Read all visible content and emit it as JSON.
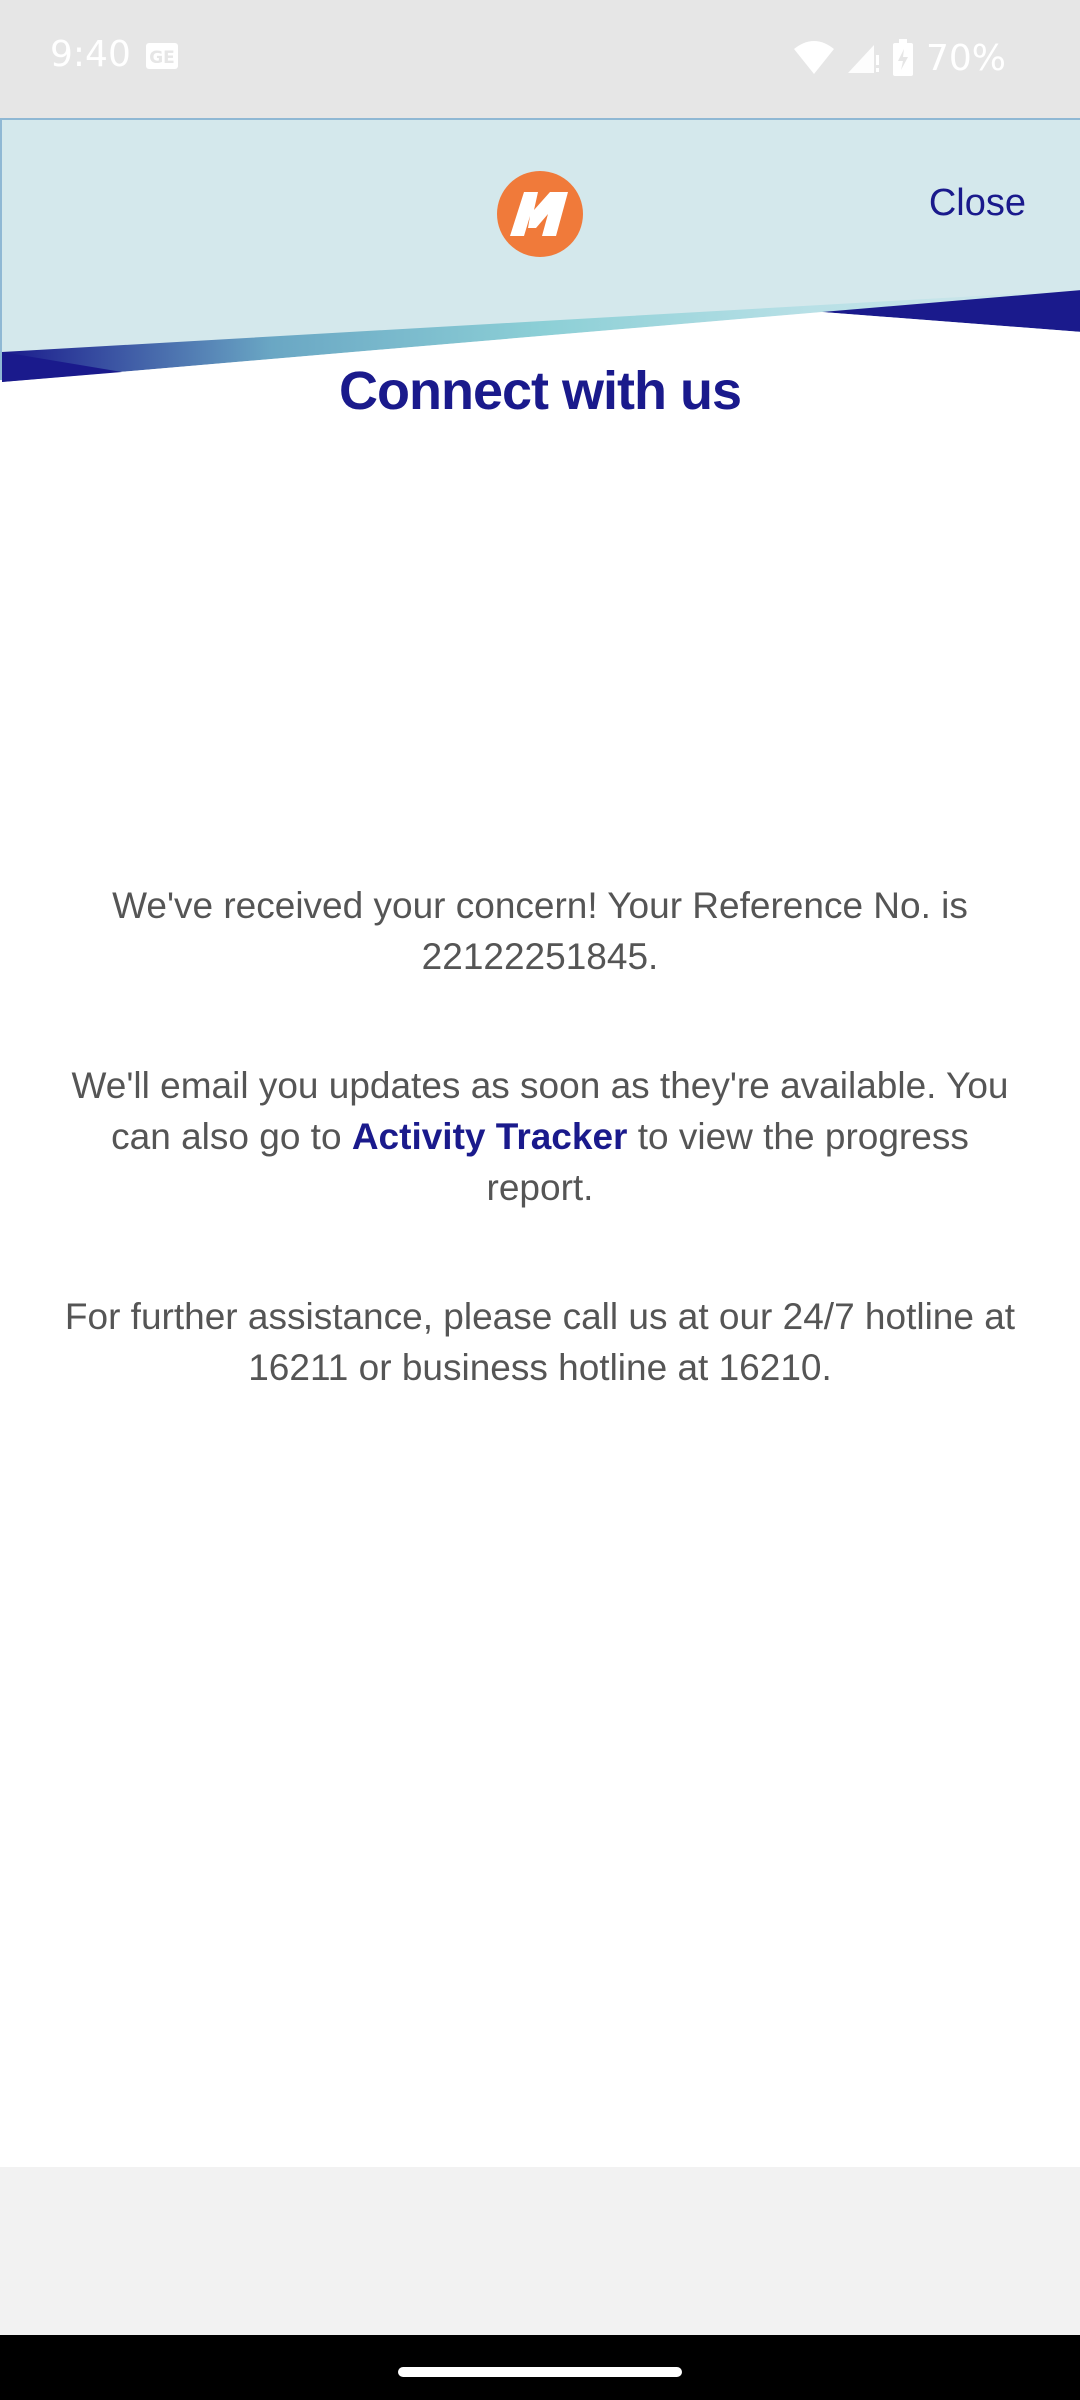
{
  "status_bar": {
    "time": "9:40",
    "battery": "70%",
    "sim_icon": "sim-card-icon",
    "wifi_icon": "wifi-icon",
    "signal_icon": "signal-icon",
    "battery_icon": "battery-charging-icon"
  },
  "header": {
    "logo_icon": "brand-logo-icon",
    "close_label": "Close",
    "colors": {
      "background": "#d4e8ec",
      "accent": "#1a1a8c",
      "logo": "#f07a3a"
    }
  },
  "title": "Connect with us",
  "messages": {
    "p1": "We've received your concern! Your Reference No. is 22122251845.",
    "p2_before": "We'll email you updates as soon as they're available. You can also go to ",
    "p2_link": "Activity Tracker",
    "p2_after": " to view the progress report.",
    "p3": "For further assistance, please call us at our 24/7 hotline at 16211 or business hotline at 16210."
  }
}
